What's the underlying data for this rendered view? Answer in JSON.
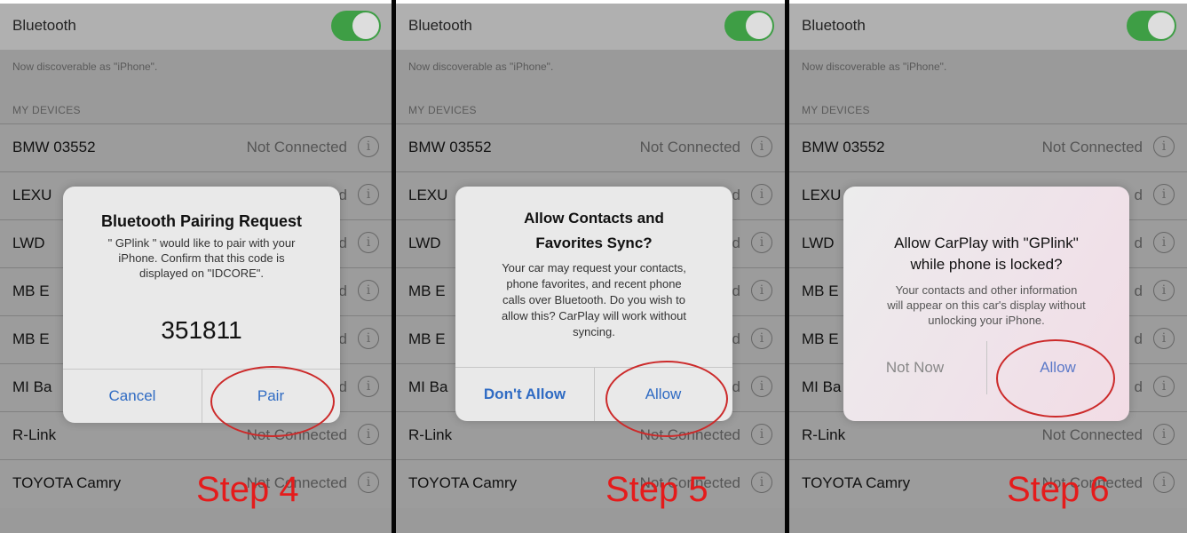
{
  "settings": {
    "bluetooth_label": "Bluetooth",
    "discoverable_text": "Now discoverable as \"iPhone\".",
    "section_header": "MY DEVICES",
    "info_glyph": "i"
  },
  "panels": [
    {
      "devices": [
        {
          "name": "BMW 03552",
          "status": "Not Connected"
        },
        {
          "name": "LEXU",
          "status": "d"
        },
        {
          "name": "LWD",
          "status": "d"
        },
        {
          "name": "MB E",
          "status": "d"
        },
        {
          "name": "MB E",
          "status": "d"
        },
        {
          "name": "MI Ba",
          "status": "d"
        },
        {
          "name": "R-Link",
          "status": "Not Connected"
        },
        {
          "name": "TOYOTA Camry",
          "status": "Not Connected"
        }
      ],
      "alert": {
        "title_lines": [
          "Bluetooth Pairing Request"
        ],
        "message_lines": [
          "\" GPlink \" would like to pair with your",
          "iPhone. Confirm that this code is",
          "displayed on \"IDCORE\"."
        ],
        "code": "351811",
        "left_button": "Cancel",
        "right_button": "Pair"
      },
      "step_label": "Step 4"
    },
    {
      "devices": [
        {
          "name": "BMW 03552",
          "status": "Not Connected"
        },
        {
          "name": "LEXU",
          "status": "d"
        },
        {
          "name": "LWD",
          "status": "d"
        },
        {
          "name": "MB E",
          "status": "d"
        },
        {
          "name": "MB E",
          "status": "d"
        },
        {
          "name": "MI Ba",
          "status": "d"
        },
        {
          "name": "R-Link",
          "status": "Not Connected"
        },
        {
          "name": "TOYOTA Camry",
          "status": "Not Connected"
        }
      ],
      "alert": {
        "title_lines": [
          "Allow Contacts and",
          "Favorites Sync?"
        ],
        "message_lines": [
          "Your car may request your contacts,",
          "phone favorites, and recent phone",
          "calls over Bluetooth. Do you wish to",
          "allow this? CarPlay will work without",
          "syncing."
        ],
        "left_button": "Don't Allow",
        "right_button": "Allow"
      },
      "step_label": "Step 5"
    },
    {
      "devices": [
        {
          "name": "BMW 03552",
          "status": "Not Connected"
        },
        {
          "name": "LEXU",
          "status": "d"
        },
        {
          "name": "LWD",
          "status": "d"
        },
        {
          "name": "MB E",
          "status": "d"
        },
        {
          "name": "MB E",
          "status": "d"
        },
        {
          "name": "MI Ba",
          "status": "d"
        },
        {
          "name": "R-Link",
          "status": "Not Connected"
        },
        {
          "name": "TOYOTA Camry",
          "status": "Not Connected"
        }
      ],
      "alert": {
        "title_lines": [
          "Allow CarPlay with \"GPlink\"",
          "while phone is locked?"
        ],
        "message_lines": [
          "Your contacts and other information",
          "will appear on this car's display without",
          "unlocking your iPhone."
        ],
        "left_button": "Not Now",
        "right_button": "Allow"
      },
      "step_label": "Step 6"
    }
  ],
  "colors": {
    "toggle_on": "#3e9e45",
    "link_blue": "#2f6bc3",
    "annotation_red": "#e51b1b"
  }
}
